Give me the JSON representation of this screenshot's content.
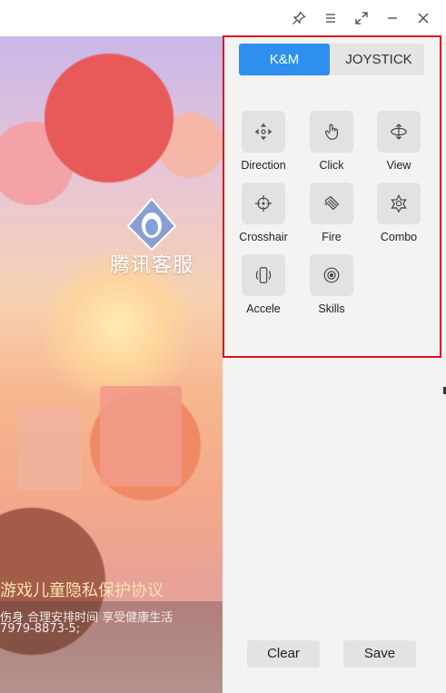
{
  "window": {
    "controls": [
      "pin-icon",
      "menu-icon",
      "fullscreen-icon",
      "minimize-icon",
      "close-icon"
    ]
  },
  "game": {
    "logo_text": "腾讯客服",
    "title": "游戏儿童隐私保护协议",
    "notice": "伤身 合理安排时间 享受健康生活",
    "phone": "7979-8873-5;"
  },
  "keymap": {
    "tabs": [
      {
        "label": "K&M",
        "active": true
      },
      {
        "label": "JOYSTICK",
        "active": false
      }
    ],
    "tools": [
      {
        "label": "Direction",
        "icon": "direction-icon"
      },
      {
        "label": "Click",
        "icon": "tap-icon"
      },
      {
        "label": "View",
        "icon": "view-rotate-icon"
      },
      {
        "label": "Crosshair",
        "icon": "crosshair-icon"
      },
      {
        "label": "Fire",
        "icon": "fire-icon"
      },
      {
        "label": "Combo",
        "icon": "combo-icon"
      },
      {
        "label": "Accele",
        "icon": "accelerometer-icon"
      },
      {
        "label": "Skills",
        "icon": "skills-icon"
      }
    ],
    "clear_label": "Clear",
    "save_label": "Save",
    "accent": "#2f8ff0",
    "highlight": "#e0101a"
  }
}
